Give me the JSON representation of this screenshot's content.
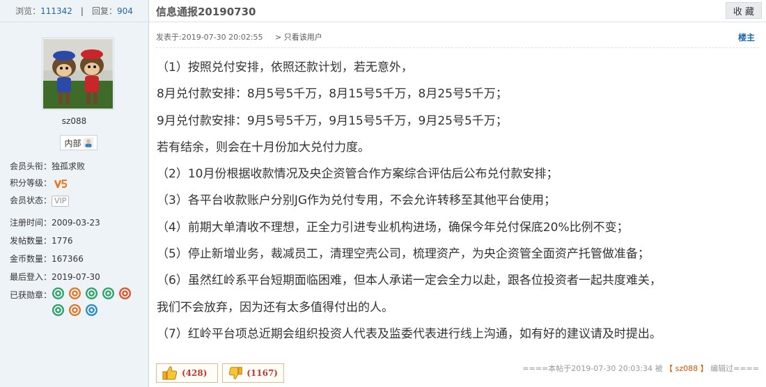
{
  "topbar": {
    "views_label": "浏览：",
    "views": "111342",
    "separator": "|",
    "replies_label": "回复：",
    "replies": "904",
    "title": "信息通报20190730",
    "favorite_button": "收 藏"
  },
  "profile": {
    "username": "sz088",
    "group": "内部",
    "fields": [
      {
        "label": "会员头衔：",
        "value": "独孤求败"
      },
      {
        "label": "积分等级：",
        "value": "",
        "icon": "v5-level-icon"
      },
      {
        "label": "会员状态：",
        "value": "VIP"
      },
      {
        "label": "注册时间：",
        "value": "2009-03-23"
      },
      {
        "label": "发帖数量：",
        "value": "1776"
      },
      {
        "label": "金币数量：",
        "value": "167366"
      },
      {
        "label": "最后登入：",
        "value": "2019-07-30"
      },
      {
        "label": "已获勋章：",
        "value": ""
      }
    ],
    "medal_colors": [
      "#2ea36b",
      "#e0782f",
      "#2ea36b",
      "#2ea36b",
      "#e0532f",
      "#2ea36b",
      "#e0782f",
      "#2a8fc9"
    ]
  },
  "post": {
    "posted_at": "发表于:2019-07-30 20:02:55",
    "only_author": "> 只看该用户",
    "floor": "楼主",
    "lines": [
      "（1）按照兑付安排，依照还款计划，若无意外，",
      "8月兑付款安排：8月5号5千万，8月15号5千万，8月25号5千万；",
      "9月兑付款安排：9月5号5千万，9月15号5千万，9月25号5千万；",
      "若有结余，则会在十月份加大兑付力度。",
      "（2）10月份根据收款情况及央企资管合作方案综合评估后公布兑付款安排；",
      "（3）各平台收款账户分别JG作为兑付专用，不会允许转移至其他平台使用；",
      "（4）前期大单清收不理想，正全力引进专业机构进场，确保今年兑付保底20%比例不变；",
      "（5）停止新增业务，裁减员工，清理空壳公司，梳理资产，为央企资管全面资产托管做准备；",
      "（6）虽然红岭系平台短期面临困难，但本人承诺一定会全力以赴，跟各位投资者一起共度难关，",
      "我们不会放弃，因为还有太多值得付出的人。",
      "（7）红岭平台项总近期会组织投资人代表及监委代表进行线上沟通，如有好的建议请及时提出。"
    ],
    "upvotes": "(428)",
    "downvotes": "(1167)",
    "edit_prefix": "====本帖于2019-07-30 20:03:34 被",
    "edit_bracket_open": "【",
    "edit_user": "sz088",
    "edit_bracket_close": "】",
    "edit_suffix": "编辑过===="
  },
  "colors": {
    "link": "#1a66b3",
    "vote_count": "#c0392b",
    "sidebar_bg": "#eef3f7"
  }
}
